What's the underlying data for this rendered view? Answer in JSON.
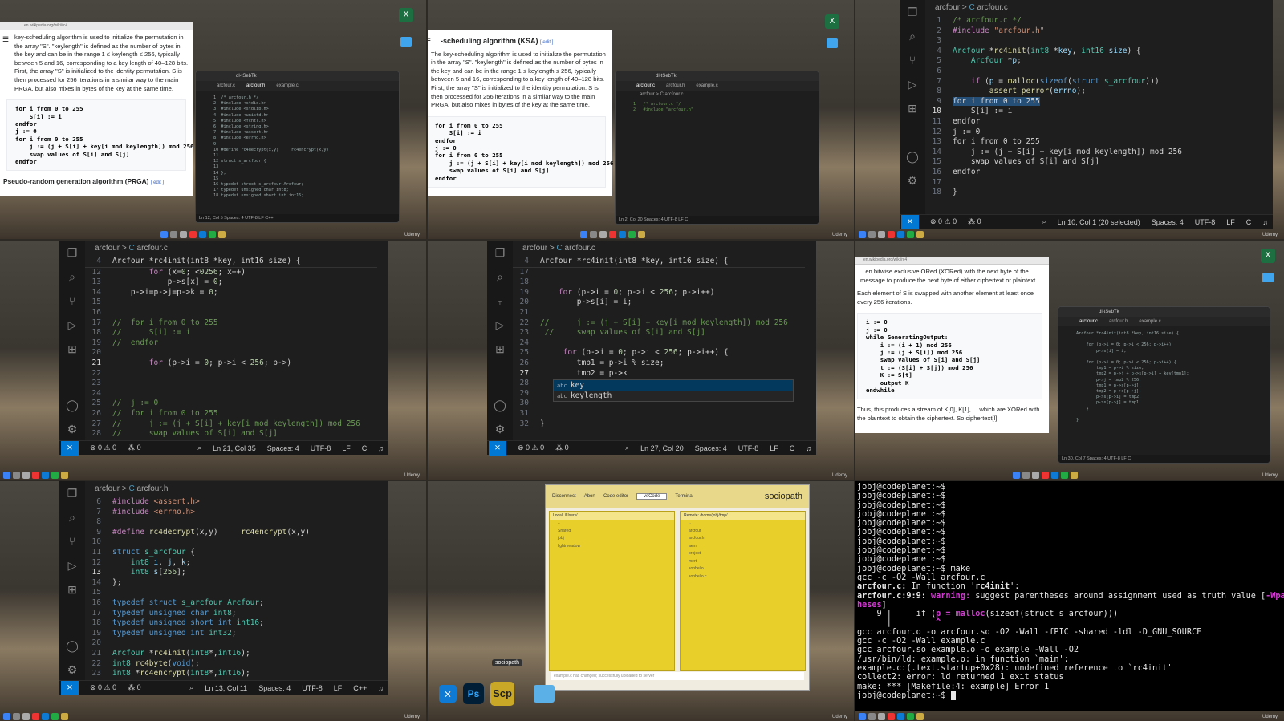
{
  "panel0": {
    "intro": "key-scheduling algorithm is used to initialize the permutation in the array \"S\". \"keylength\" is defined as the number of bytes in the key and can be in the range 1 ≤ keylength ≤ 256, typically between 5 and 16, corresponding to a key length of 40–128 bits. First, the array \"S\" is initialized to the identity permutation. S is then processed for 256 iterations in a similar way to the main PRGA, but also mixes in bytes of the key at the same time.",
    "pseudocode": "for i from 0 to 255\n    S[i] := i\nendfor\nj := 0\nfor i from 0 to 255\n    j := (j + S[i] + key[i mod keylength]) mod 256\n    swap values of S[i] and S[j]\nendfor",
    "heading": "Pseudo-random generation algorithm (PRGA)",
    "edit": "[ edit ]",
    "mini_tabs": [
      "arcfour.c",
      "arcfour.h",
      "example.c"
    ],
    "mini_search": "dl-tSebTk",
    "mini_status": "Ln 12, Col 5   Spaces: 4   UTF-8   LF   C++"
  },
  "panel1": {
    "heading": "-scheduling algorithm (KSA)",
    "edit": "[ edit ]",
    "intro": "The key-scheduling algorithm is used to initialize the permutation in the array \"S\". \"keylength\" is defined as the number of bytes in the key and can be in the range 1 ≤ keylength ≤ 256, typically between 5 and 16, corresponding to a key length of 40–128 bits. First, the array \"S\" is initialized to the identity permutation. S is then processed for 256 iterations in a similar way to the main PRGA, but also mixes in bytes of the key at the same time.",
    "pseudocode": "for i from 0 to 255\n    S[i] := i\nendfor\nj := 0\nfor i from 0 to 255\n    j := (j + S[i] + key[i mod keylength]) mod 256\n    swap values of S[i] and S[j]\nendfor",
    "mini_tabs": [
      "arcfour.c",
      "arcfour.h",
      "example.c"
    ],
    "mini_search": "dl-tSebTk",
    "mini_breadcrumb": "arcfour > C arcfour.c",
    "mini_code": "1   /* arcfour.c */\n2   #include \"arcfour.h\"",
    "mini_status": "Ln 2, Col 20   Spaces: 4   UTF-8   LF   C"
  },
  "panel2": {
    "breadcrumb_folder": "arcfour",
    "breadcrumb_file": "arcfour.c",
    "status": {
      "problems": "⊗ 0 ⚠ 0",
      "ports": "⁂ 0",
      "position": "Ln 10, Col 1 (20 selected)",
      "spaces": "Spaces: 4",
      "encoding": "UTF-8",
      "eol": "LF",
      "lang": "C"
    }
  },
  "panel3": {
    "breadcrumb_folder": "arcfour",
    "breadcrumb_file": "arcfour.c",
    "sticky": "Arcfour *rc4init(int8 *key, int16 size) {",
    "status": {
      "problems": "⊗ 0 ⚠ 0",
      "ports": "⁂ 0",
      "position": "Ln 21, Col 35",
      "spaces": "Spaces: 4",
      "encoding": "UTF-8",
      "eol": "LF",
      "lang": "C"
    }
  },
  "panel4": {
    "breadcrumb_folder": "arcfour",
    "breadcrumb_file": "arcfour.c",
    "sticky": "Arcfour *rc4init(int8 *key, int16 size) {",
    "suggestions": [
      "key",
      "keylength"
    ],
    "status": {
      "problems": "⊗ 0 ⚠ 0",
      "ports": "⁂ 0",
      "position": "Ln 27, Col 20",
      "spaces": "Spaces: 4",
      "encoding": "UTF-8",
      "eol": "LF",
      "lang": "C"
    }
  },
  "panel5": {
    "intro": "...en bitwise exclusive ORed (XORed) with the next byte of the message to produce the next byte of either ciphertext or plaintext.",
    "swap_note": "Each element of S is swapped with another element at least once every 256 iterations.",
    "pseudocode": "i := 0\nj := 0\nwhile GeneratingOutput:\n    i := (i + 1) mod 256\n    j := (j + S[i]) mod 256\n    swap values of S[i] and S[j]\n    t := (S[i] + S[j]) mod 256\n    K := S[t]\n    output K\nendwhile",
    "outro": "Thus, this produces a stream of K[0], K[1], ... which are XORed with the plaintext to obtain the ciphertext. So ciphertext[l]",
    "mini_tabs": [
      "arcfour.c",
      "arcfour.h",
      "example.c"
    ],
    "mini_search": "dl-tSebTk",
    "mini_status": "Ln 30, Col 7   Spaces: 4   UTF-8   LF   C"
  },
  "panel6": {
    "breadcrumb_folder": "arcfour",
    "breadcrumb_file": "arcfour.h",
    "status": {
      "problems": "⊗ 0 ⚠ 0",
      "ports": "⁂ 0",
      "position": "Ln 13, Col 11",
      "spaces": "Spaces: 4",
      "encoding": "UTF-8",
      "eol": "LF",
      "lang": "C++"
    }
  },
  "panel7": {
    "toolbar": [
      "Disconnect",
      "Abort",
      "Code editor",
      "Terminal"
    ],
    "editor_select": "vsCode",
    "brand": "sociopath",
    "local_path": "Local: /Users/",
    "local_items": [
      "..",
      "Shared",
      "jobj",
      "lightmeadow"
    ],
    "remote_path": "Remote: /home/jobj/tmp/",
    "remote_items": [
      "..",
      "arcfour",
      "arcfour.h",
      "aem",
      "project",
      "mert",
      "sophello",
      "sophello.c"
    ],
    "status_line": "example.c has changed; successfully uploaded to server",
    "dock_tooltip": "sociopath"
  },
  "panel8": {
    "prompt": "jobj@codeplanet:~$"
  },
  "udemy": "Udemy"
}
